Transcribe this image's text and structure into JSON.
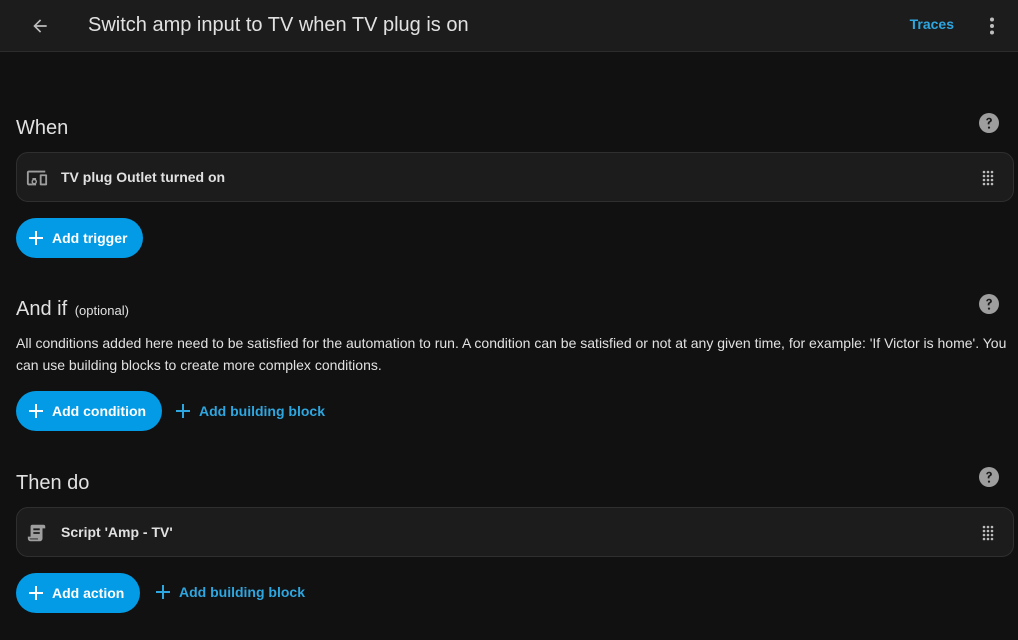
{
  "header": {
    "title": "Switch amp input to TV when TV plug is on",
    "traces_label": "Traces",
    "back_icon": "arrow-left-icon",
    "menu_icon": "dots-vertical-icon"
  },
  "colors": {
    "background": "#111111",
    "card": "#1c1c1c",
    "accent": "#039be5",
    "link": "#2ea6e0"
  },
  "triggers": {
    "title": "When",
    "items": [
      {
        "label": "TV plug Outlet turned on",
        "icon": "devices-icon"
      }
    ],
    "add_label": "Add trigger"
  },
  "conditions": {
    "title": "And if",
    "optional_label": "(optional)",
    "description": "All conditions added here need to be satisfied for the automation to run. A condition can be satisfied or not at any given time, for example: 'If Victor is home'. You can use building blocks to create more complex conditions.",
    "add_label": "Add condition",
    "building_block_label": "Add building block"
  },
  "actions": {
    "title": "Then do",
    "items": [
      {
        "label": "Script 'Amp - TV'",
        "icon": "script-icon"
      }
    ],
    "add_label": "Add action",
    "building_block_label": "Add building block"
  }
}
